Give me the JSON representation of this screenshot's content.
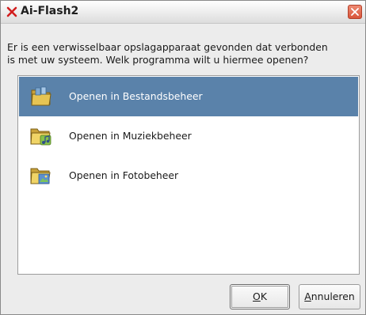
{
  "window": {
    "title": "Ai-Flash2",
    "app_icon": "red-x-icon",
    "close_icon": "close-icon"
  },
  "message": {
    "line1": "Er is een verwisselbaar opslagapparaat gevonden dat verbonden",
    "line2": "is met uw systeem. Welk programma wilt u hiermee openen?"
  },
  "options": [
    {
      "label": "Openen in Bestandsbeheer",
      "icon": "file-manager-folder-icon",
      "selected": true
    },
    {
      "label": "Openen in Muziekbeheer",
      "icon": "music-folder-icon",
      "selected": false
    },
    {
      "label": "Openen in Fotobeheer",
      "icon": "photo-folder-icon",
      "selected": false
    }
  ],
  "buttons": {
    "ok": {
      "mnemonic": "O",
      "rest": "K"
    },
    "cancel": {
      "mnemonic": "A",
      "rest": "nnuleren"
    }
  },
  "colors": {
    "selection": "#5a82aa",
    "close_button": "#d9553a"
  }
}
